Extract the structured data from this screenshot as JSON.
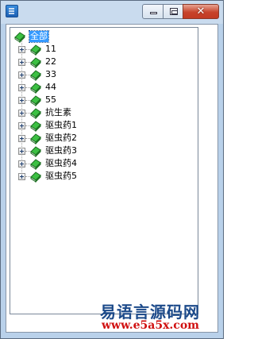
{
  "window": {
    "title": "",
    "close_label": "✕"
  },
  "tree": {
    "root": {
      "label": "全部",
      "selected": true
    },
    "items": [
      {
        "label": "11"
      },
      {
        "label": "22"
      },
      {
        "label": "33"
      },
      {
        "label": "44"
      },
      {
        "label": "55"
      },
      {
        "label": "抗生素"
      },
      {
        "label": "驱虫药1"
      },
      {
        "label": "驱虫药2"
      },
      {
        "label": "驱虫药3"
      },
      {
        "label": "驱虫药4"
      },
      {
        "label": "驱虫药5"
      }
    ]
  },
  "watermark": {
    "title": "易语言源码网",
    "url": "www.e5a5x.com"
  },
  "colors": {
    "selection": "#3399ff",
    "book_green": "#2fb33a",
    "watermark_blue": "#1c4a8a",
    "watermark_red": "#d01010"
  },
  "icons": {
    "app": "app-icon",
    "node": "book-icon",
    "expander": "plus-expander-icon"
  }
}
